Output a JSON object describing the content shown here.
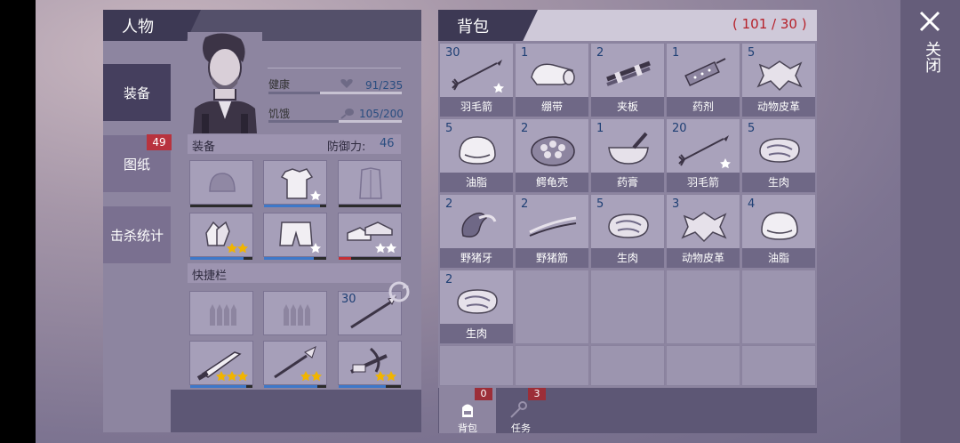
{
  "window": {
    "close_label": "关闭"
  },
  "character": {
    "title": "人物",
    "tabs": [
      {
        "label": "装备",
        "active": true
      },
      {
        "label": "图纸",
        "badge": "49"
      },
      {
        "label": "击杀统计"
      }
    ],
    "stats": {
      "health_label": "健康",
      "health_value": "91/235",
      "health_fraction": 0.387,
      "hunger_label": "饥饿",
      "hunger_value": "105/200",
      "hunger_fraction": 0.525
    },
    "equipment": {
      "label": "装备",
      "defense_label": "防御力:",
      "defense_value": "46",
      "slots": [
        {
          "icon": "helmet-icon",
          "durability": 0
        },
        {
          "icon": "shirt-icon",
          "stars": 1,
          "durability": 0.9
        },
        {
          "icon": "jacket-icon",
          "durability": 0
        },
        {
          "icon": "gloves-icon",
          "stars": 2,
          "durability": 0.85
        },
        {
          "icon": "shorts-icon",
          "stars": 1,
          "durability": 0.8
        },
        {
          "icon": "shoes-icon",
          "stars": 2,
          "durability": 0.2
        }
      ]
    },
    "quickbar": {
      "label": "快捷栏",
      "slots": [
        {
          "icon": "ammo-icon"
        },
        {
          "icon": "ammo-icon"
        },
        {
          "icon": "spear-icon",
          "qty": "30"
        },
        {
          "icon": "machete-icon",
          "stars": 3,
          "durability": 0.9
        },
        {
          "icon": "spear-tip-icon",
          "stars": 2,
          "durability": 0.85
        },
        {
          "icon": "crossbow-icon",
          "stars": 2,
          "durability": 0.75
        }
      ]
    }
  },
  "backpack": {
    "title": "背包",
    "count": "( 101 / 30 )",
    "items": [
      {
        "qty": "30",
        "name": "羽毛箭",
        "icon": "arrow-icon"
      },
      {
        "qty": "1",
        "name": "绷带",
        "icon": "bandage-icon"
      },
      {
        "qty": "2",
        "name": "夹板",
        "icon": "splint-icon"
      },
      {
        "qty": "1",
        "name": "药剂",
        "icon": "syringe-icon"
      },
      {
        "qty": "5",
        "name": "动物皮革",
        "icon": "hide-icon"
      },
      {
        "qty": "5",
        "name": "油脂",
        "icon": "fat-icon"
      },
      {
        "qty": "2",
        "name": "鳄龟壳",
        "icon": "shell-icon"
      },
      {
        "qty": "1",
        "name": "药膏",
        "icon": "mortar-icon"
      },
      {
        "qty": "20",
        "name": "羽毛箭",
        "icon": "arrow-icon"
      },
      {
        "qty": "5",
        "name": "生肉",
        "icon": "meat-icon"
      },
      {
        "qty": "2",
        "name": "野猪牙",
        "icon": "tusk-icon"
      },
      {
        "qty": "2",
        "name": "野猪筋",
        "icon": "sinew-icon"
      },
      {
        "qty": "5",
        "name": "生肉",
        "icon": "meat-icon"
      },
      {
        "qty": "3",
        "name": "动物皮革",
        "icon": "hide-icon"
      },
      {
        "qty": "4",
        "name": "油脂",
        "icon": "fat-icon"
      },
      {
        "qty": "2",
        "name": "生肉",
        "icon": "meat-icon"
      }
    ],
    "tabs": [
      {
        "label": "背包",
        "badge": "0",
        "active": true
      },
      {
        "label": "任务",
        "badge": "3"
      }
    ]
  }
}
